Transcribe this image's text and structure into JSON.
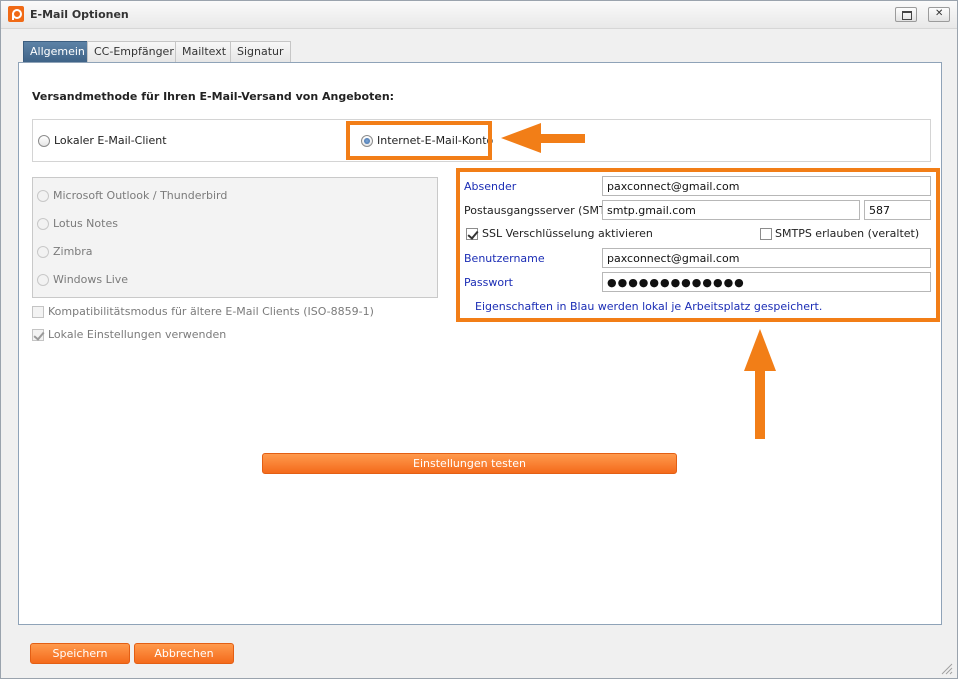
{
  "window": {
    "title": "E-Mail Optionen"
  },
  "tabs": [
    "Allgemein",
    "CC-Empfänger",
    "Mailtext",
    "Signatur"
  ],
  "general": {
    "section_title": "Versandmethode für Ihren E-Mail-Versand von Angeboten:",
    "method_local": "Lokaler E-Mail-Client",
    "method_internet": "Internet-E-Mail-Konto",
    "clients": [
      "Microsoft Outlook / Thunderbird",
      "Lotus Notes",
      "Zimbra",
      "Windows Live"
    ],
    "compat_mode": "Kompatibilitätsmodus für ältere E-Mail Clients (ISO-8859-1)",
    "local_settings": "Lokale Einstellungen verwenden",
    "selected_method": "Internet-E-Mail-Konto"
  },
  "account": {
    "sender_label": "Absender",
    "sender_value": "paxconnect@gmail.com",
    "smtp_label": "Postausgangsserver (SMTP)",
    "smtp_value": "smtp.gmail.com",
    "port_value": "587",
    "ssl_label": "SSL Verschlüsselung aktivieren",
    "smtps_label": "SMTPS erlauben (veraltet)",
    "username_label": "Benutzername",
    "username_value": "paxconnect@gmail.com",
    "password_label": "Passwort",
    "password_value": "●●●●●●●●●●●●●",
    "note": "Eigenschaften in Blau werden lokal je Arbeitsplatz gespeichert."
  },
  "buttons": {
    "test": "Einstellungen testen",
    "save": "Speichern",
    "cancel": "Abbrechen"
  },
  "colors": {
    "accent": "#f27e17",
    "tab_active": "#4a6f95",
    "blue_label": "#1b2db5"
  }
}
